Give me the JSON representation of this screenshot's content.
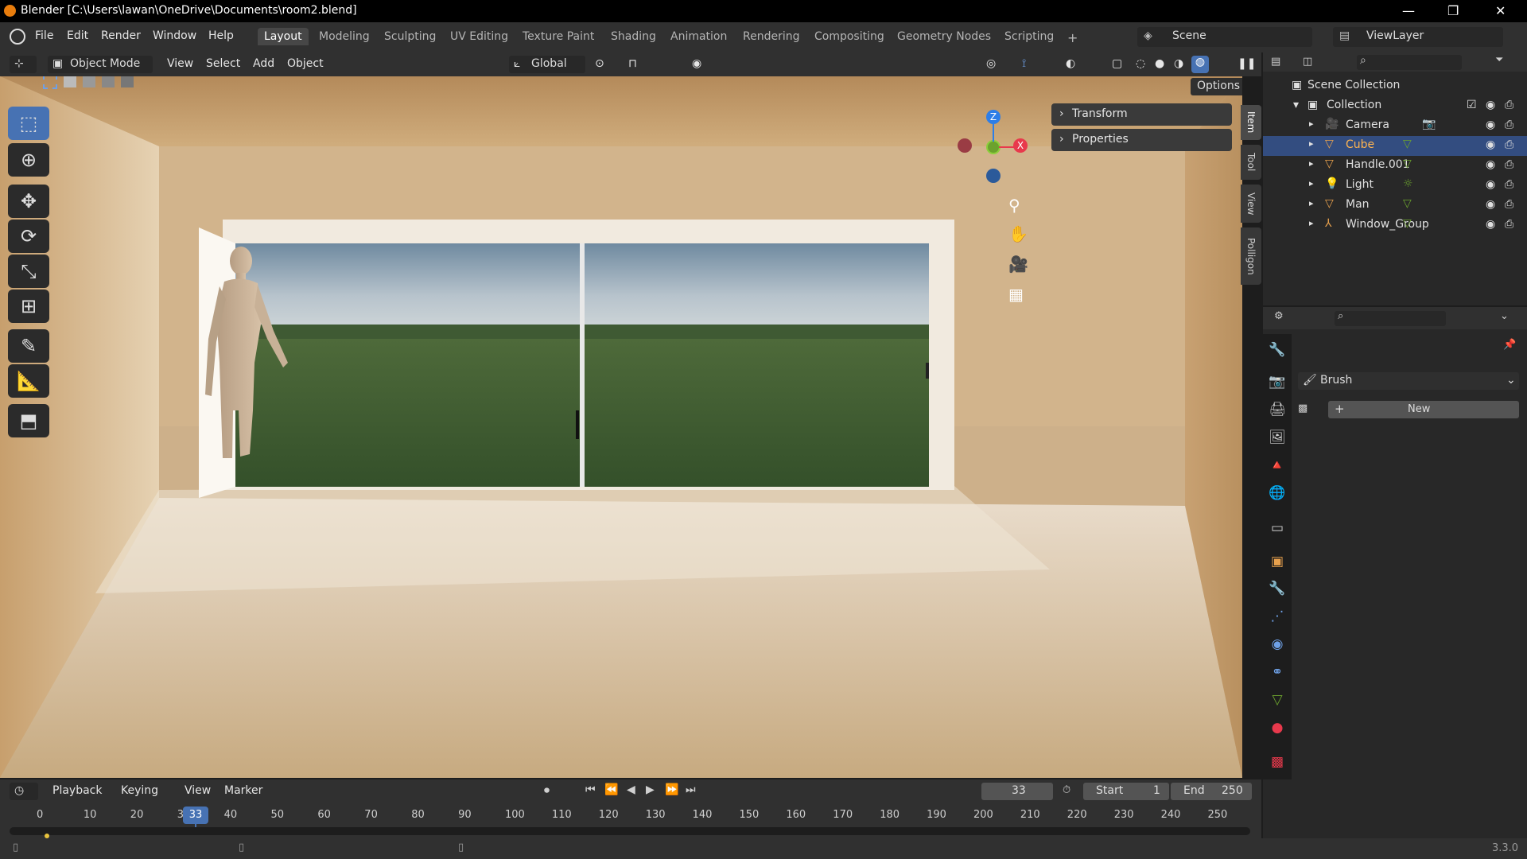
{
  "window": {
    "title": "Blender [C:\\Users\\lawan\\OneDrive\\Documents\\room2.blend]",
    "controls": [
      "—",
      "❐",
      "✕"
    ]
  },
  "menus": [
    "File",
    "Edit",
    "Render",
    "Window",
    "Help"
  ],
  "workspaces": [
    "Layout",
    "Modeling",
    "Sculpting",
    "UV Editing",
    "Texture Paint",
    "Shading",
    "Animation",
    "Rendering",
    "Compositing",
    "Geometry Nodes",
    "Scripting"
  ],
  "workspace_add": "+",
  "scene": {
    "name": "Scene",
    "view_layer": "ViewLayer"
  },
  "viewport_header": {
    "mode": "Object Mode",
    "menus": [
      "View",
      "Select",
      "Add",
      "Object"
    ],
    "orientation": "Global",
    "options": "Options"
  },
  "gizmo": {
    "x": "X",
    "y": "",
    "z": "Z"
  },
  "n_panel": {
    "sections": [
      "Transform",
      "Properties"
    ],
    "tabs": [
      "Item",
      "Tool",
      "View",
      "Polligon"
    ]
  },
  "outliner": {
    "root": "Scene Collection",
    "collection": "Collection",
    "items": [
      {
        "name": "Camera",
        "icon": "camera-icon",
        "data_icon": "camera-data-icon",
        "selected": false
      },
      {
        "name": "Cube",
        "icon": "mesh-icon",
        "data_icon": "mesh-data-icon",
        "selected": true
      },
      {
        "name": "Handle.001",
        "icon": "mesh-icon",
        "data_icon": "mesh-data-icon",
        "selected": false
      },
      {
        "name": "Light",
        "icon": "light-icon",
        "data_icon": "light-data-icon",
        "selected": false
      },
      {
        "name": "Man",
        "icon": "mesh-icon",
        "data_icon": "mesh-data-icon",
        "selected": false
      },
      {
        "name": "Window_Group",
        "icon": "empty-icon",
        "data_icon": "mesh-data-icon",
        "selected": false
      }
    ]
  },
  "properties": {
    "brush_label": "Brush",
    "new_label": "New",
    "new_plus": "+"
  },
  "timeline": {
    "menus": [
      "Playback",
      "Keying",
      "View",
      "Marker"
    ],
    "current_frame": "33",
    "start_label": "Start",
    "start": "1",
    "end_label": "End",
    "end": "250",
    "ticks": [
      "0",
      "10",
      "20",
      "3",
      "40",
      "50",
      "60",
      "70",
      "80",
      "90",
      "100",
      "110",
      "120",
      "130",
      "140",
      "150",
      "160",
      "170",
      "180",
      "190",
      "200",
      "210",
      "220",
      "230",
      "240",
      "250"
    ],
    "playhead": "33"
  },
  "status": {
    "version": "3.3.0"
  },
  "colors": {
    "accent": "#4772b3",
    "selected_row": "#334d80",
    "axis_x": "#e8394c",
    "axis_y": "#6ba22e",
    "axis_z": "#2d7ee8",
    "object_orange": "#e8a14d"
  }
}
